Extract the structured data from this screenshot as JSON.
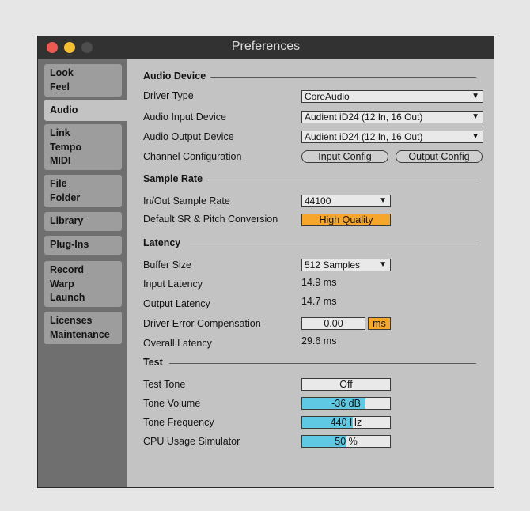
{
  "window": {
    "title": "Preferences"
  },
  "sidebar": {
    "tabs": [
      {
        "lines": [
          "Look",
          "Feel"
        ]
      },
      {
        "lines": [
          "Audio"
        ],
        "active": true
      },
      {
        "lines": [
          "Link",
          "Tempo",
          "MIDI"
        ]
      },
      {
        "lines": [
          "File",
          "Folder"
        ]
      },
      {
        "lines": [
          "Library"
        ]
      },
      {
        "lines": [
          "Plug-Ins"
        ]
      },
      {
        "lines": [
          "Record",
          "Warp",
          "Launch"
        ]
      },
      {
        "lines": [
          "Licenses",
          "Maintenance"
        ]
      }
    ]
  },
  "audio_device": {
    "heading": "Audio Device",
    "driver_type_label": "Driver Type",
    "driver_type_value": "CoreAudio",
    "input_device_label": "Audio Input Device",
    "input_device_value": "Audient iD24 (12 In, 16 Out)",
    "output_device_label": "Audio Output Device",
    "output_device_value": "Audient iD24 (12 In, 16 Out)",
    "channel_config_label": "Channel Configuration",
    "input_config_button": "Input Config",
    "output_config_button": "Output Config"
  },
  "sample_rate": {
    "heading": "Sample Rate",
    "rate_label": "In/Out Sample Rate",
    "rate_value": "44100",
    "conversion_label": "Default SR & Pitch Conversion",
    "conversion_value": "High Quality"
  },
  "latency": {
    "heading": "Latency",
    "buffer_label": "Buffer Size",
    "buffer_value": "512 Samples",
    "input_label": "Input Latency",
    "input_value": "14.9 ms",
    "output_label": "Output Latency",
    "output_value": "14.7 ms",
    "compensation_label": "Driver Error Compensation",
    "compensation_value": "0.00",
    "compensation_unit": "ms",
    "overall_label": "Overall Latency",
    "overall_value": "29.6 ms"
  },
  "test": {
    "heading": "Test",
    "tone_label": "Test Tone",
    "tone_value": "Off",
    "volume_label": "Tone Volume",
    "volume_value": "-36 dB",
    "volume_level": 0.72,
    "frequency_label": "Tone Frequency",
    "frequency_value": "440 Hz",
    "frequency_level": 0.58,
    "cpu_label": "CPU Usage Simulator",
    "cpu_value": "50 %",
    "cpu_level": 0.5
  },
  "colors": {
    "accent_orange": "#f6a62a",
    "slider_fill": "#5fc9e4"
  }
}
